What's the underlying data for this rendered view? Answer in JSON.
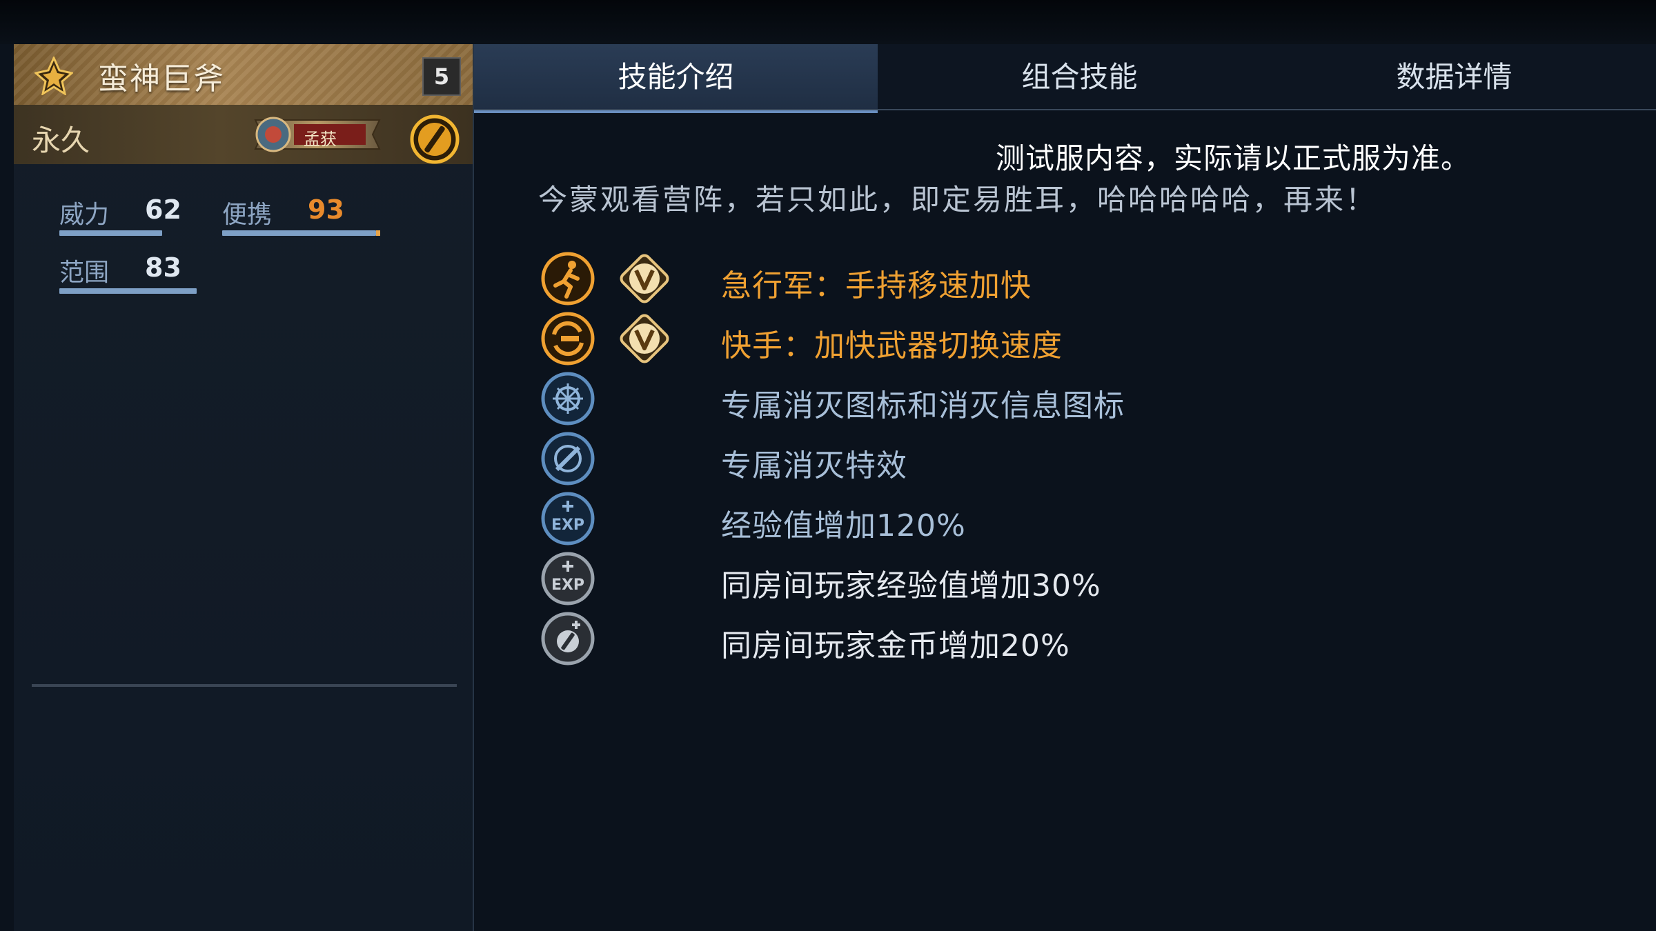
{
  "weapon": {
    "name": "蛮神巨斧",
    "level": "5",
    "duration": "永久",
    "hero_badge_name": "孟获"
  },
  "stats": [
    {
      "label": "威力",
      "value": "62",
      "level": 0.62
    },
    {
      "label": "便携",
      "value": "93",
      "level": 0.93,
      "highlight": "#e88a2c"
    },
    {
      "label": "范围",
      "value": "83",
      "level": 0.83
    }
  ],
  "tabs": [
    {
      "label": "技能介绍",
      "active": true
    },
    {
      "label": "组合技能",
      "active": false
    },
    {
      "label": "数据详情",
      "active": false
    }
  ],
  "content": {
    "notice": "测试服内容，实际请以正式服为准。",
    "quote": "今蒙观看营阵，若只如此，即定易胜耳，哈哈哈哈哈，再来！",
    "skills": [
      {
        "icon": "running-man-icon",
        "has_v": true,
        "text": "急行军：手持移速加快",
        "color": "orange"
      },
      {
        "icon": "quick-hand-icon",
        "has_v": true,
        "text": "快手：加快武器切换速度",
        "color": "orange"
      },
      {
        "icon": "elimination-icon",
        "has_v": false,
        "text": "专属消灭图标和消灭信息图标",
        "color": "blue"
      },
      {
        "icon": "elimination-effect-icon",
        "has_v": false,
        "text": "专属消灭特效",
        "color": "blue"
      },
      {
        "icon": "exp-plus-icon",
        "has_v": false,
        "text": "经验值增加120%",
        "color": "blue"
      },
      {
        "icon": "room-exp-icon",
        "has_v": false,
        "text": "同房间玩家经验值增加30%",
        "color": "white"
      },
      {
        "icon": "room-gold-icon",
        "has_v": false,
        "text": "同房间玩家金币增加20%",
        "color": "white"
      }
    ]
  },
  "colors": {
    "orange_text": "#f0a132",
    "blue_text": "#a8bfd8",
    "white_text": "#e4e8ee",
    "tab_active": "#1f2e43"
  }
}
